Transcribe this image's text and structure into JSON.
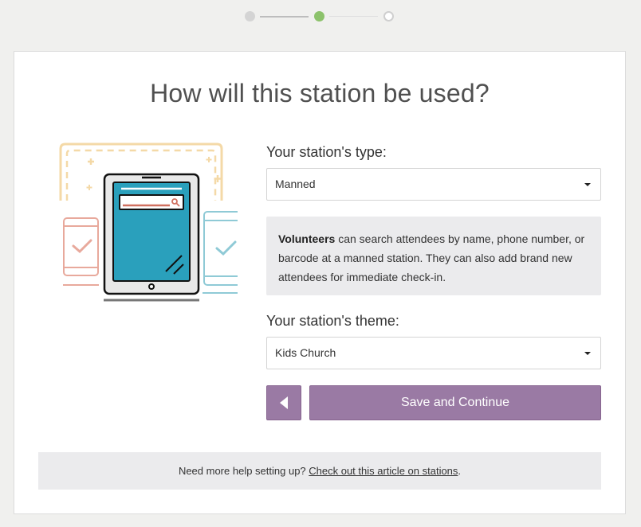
{
  "stepper": {
    "steps": 3,
    "current_step": 2
  },
  "page": {
    "title": "How will this station be used?"
  },
  "station_type": {
    "label": "Your station's type:",
    "selected": "Manned"
  },
  "info": {
    "bold": "Volunteers",
    "text": " can search attendees by name, phone number, or barcode at a manned station. They can also add brand new attendees for immediate check-in."
  },
  "station_theme": {
    "label": "Your station's theme:",
    "selected": "Kids Church"
  },
  "actions": {
    "save_label": "Save and Continue",
    "back_icon": "caret-left-icon"
  },
  "help": {
    "text": "Need more help setting up? ",
    "link_text": "Check out this article on stations",
    "suffix": "."
  },
  "colors": {
    "accent": "#9a7aa4",
    "step_active": "#8cc26b",
    "tablet_screen": "#2aa0bc",
    "phone_left": "#e8a99c",
    "phone_right": "#8fcad6",
    "frame": "#f4d9a7"
  }
}
